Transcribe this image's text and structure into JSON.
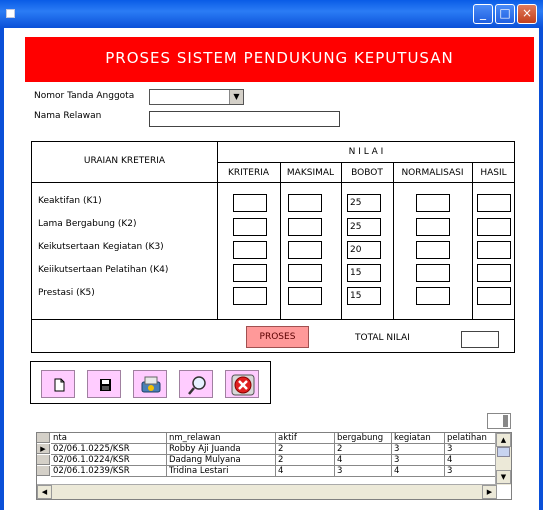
{
  "window": {
    "minimize": "_",
    "maximize": "□",
    "close": "×"
  },
  "header": {
    "title": "PROSES SISTEM PENDUKUNG KEPUTUSAN"
  },
  "form": {
    "nomor_label": "Nomor Tanda Anggota",
    "nomor_value": "",
    "nama_label": "Nama Relawan",
    "nama_value": ""
  },
  "criteria": {
    "uraian_header": "URAIAN KRETERIA",
    "nilai_header": "N I L A I",
    "columns": [
      "KRITERIA",
      "MAKSIMAL",
      "BOBOT",
      "NORMALISASI",
      "HASIL"
    ],
    "rows": [
      {
        "label": "Keaktifan (K1)",
        "bobot": "25"
      },
      {
        "label": "Lama Bergabung (K2)",
        "bobot": "25"
      },
      {
        "label": "Keikutsertaan Kegiatan (K3)",
        "bobot": "20"
      },
      {
        "label": "Keiikutsertaan Pelatihan (K4)",
        "bobot": "15"
      },
      {
        "label": "Prestasi (K5)",
        "bobot": "15"
      }
    ],
    "proses_label": "PROSES",
    "total_label": "TOTAL NILAI",
    "total_value": ""
  },
  "toolbar": {
    "icons": [
      "new-icon",
      "save-icon",
      "print-icon",
      "search-icon",
      "close-icon"
    ]
  },
  "grid": {
    "columns": [
      "nta",
      "nm_relawan",
      "aktif",
      "bergabung",
      "kegiatan",
      "pelatihan"
    ],
    "rows": [
      [
        "02/06.1.0225/KSR",
        "Robby Aji Juanda",
        "2",
        "2",
        "3",
        "3"
      ],
      [
        "02/06.1.0224/KSR",
        "Dadang Mulyana",
        "2",
        "4",
        "3",
        "4"
      ],
      [
        "02/06.1.0239/KSR",
        "Tridina Lestari",
        "4",
        "3",
        "4",
        "3"
      ]
    ],
    "selected_marker": "▶"
  },
  "colors": {
    "header_bg": "#ff0000",
    "tool_bg": "#ffccff",
    "proses_bg": "#ff9999",
    "titlebar": "#0a5ce6"
  }
}
